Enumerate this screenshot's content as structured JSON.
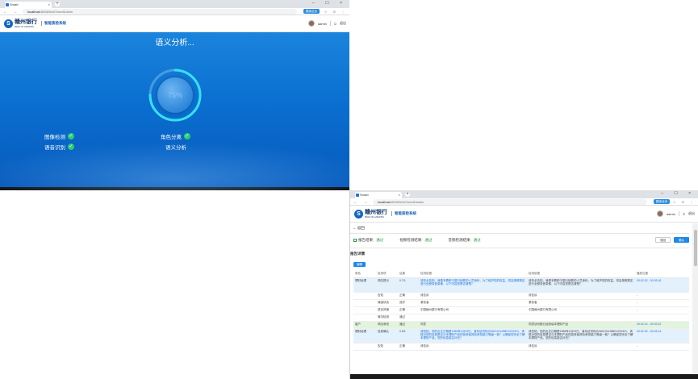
{
  "browser": {
    "tab_title": "Smart",
    "tab_close": "×",
    "new_tab": "+",
    "window_controls": "– ☐ ×",
    "nav": "← → ⟳",
    "url_host": "localhost",
    "url_path": ":8058/#/sl/SmartAdmin",
    "url_path_2": ":8058/#/sl/SmartDetails",
    "translate_badge": "翻译此页",
    "addr_right": "☆ ⊙ ⋮"
  },
  "header": {
    "logo_mark": "S",
    "bank_cn": "赣州银行",
    "bank_en": "BANK OF GANZHOU",
    "system_name": "智能质检系统",
    "username": "admin",
    "logout": "退出"
  },
  "analysis": {
    "title": "语义分析...",
    "percent": "75%",
    "progress": 0.75,
    "steps_left": [
      "图像检测",
      "语音识别"
    ],
    "step_right_done": "角色分离",
    "step_right_current": "语义分析",
    "check": "✓"
  },
  "details": {
    "back": "← 返回",
    "results": [
      {
        "label": "报告结果:",
        "value": "通过"
      },
      {
        "label": "视频检测结果:",
        "value": "通过"
      },
      {
        "label": "音频检测结果:",
        "value": "通过"
      }
    ],
    "buttons": {
      "secondary": "驳回",
      "primary": "确认"
    },
    "section_title": "报告详情",
    "edit_button": "编辑",
    "columns": [
      "角色",
      "检测项",
      "结果",
      "检测依据",
      "检测依据",
      "播放位置"
    ],
    "rows": [
      {
        "role": "理财经理",
        "item": "风险提示",
        "result": "0.7/1",
        "basis": "请务必告知，我是本着职于银行销售的人员身份，为了维护您的权益，将会按照规定进行全程录音录像，以下内容您是否清楚？",
        "text": "请务必告知，我是本着职于银行销售的人员身份，为了维护您的权益，将会按照规定进行全程录音录像，以下内容您是否清楚？",
        "pos": "00:02:32 - 00:03:16",
        "style": "blue"
      },
      {
        "role": "",
        "item": "告知",
        "result": "正确",
        "basis": "请告诉",
        "text": "请告诉",
        "pos": "-",
        "style": ""
      },
      {
        "role": "",
        "item": "情绪状态",
        "result": "良好",
        "basis": "紧张者",
        "text": "紧张者",
        "pos": "-",
        "style": ""
      },
      {
        "role": "",
        "item": "语言风格",
        "result": "正确",
        "basis": "中国赣州银行有限公司",
        "text": "中国赣州银行有限公司",
        "pos": "-",
        "style": ""
      },
      {
        "role": "",
        "item": "情况检测",
        "result": "通过",
        "basis": "",
        "text": "",
        "pos": "",
        "style": ""
      },
      {
        "role": "客户",
        "item": "风险承担",
        "result": "通过",
        "basis": "同意",
        "text": "同意该份额已经知晓本理财产品",
        "pos": "00:02:14 - 00:03:22",
        "style": "green"
      },
      {
        "role": "理财经理",
        "item": "信息确认",
        "result": "0.5/1",
        "basis": "请告知，您的出生日期是1988年1月23日，身份证号码为360101198801234321，请核对您的信息是否与本理财产品的投资者风险承担能力等级一致？以确保您完全了解本理财产品，您的信息能否补充？",
        "text": "请告知，您的出生日期是1988年1月23日，身份证号码为360101198801234321，请核对您的信息是否与本理财产品的投资者风险承担能力等级一致？以确保您完全了解本理财产品，您的信息能否补充？",
        "pos": "00:02:32 - 00:03:14",
        "style": "blue"
      },
      {
        "role": "",
        "item": "告知",
        "result": "正确",
        "basis": "请告诉",
        "text": "请告诉",
        "pos": "-",
        "style": ""
      }
    ]
  }
}
